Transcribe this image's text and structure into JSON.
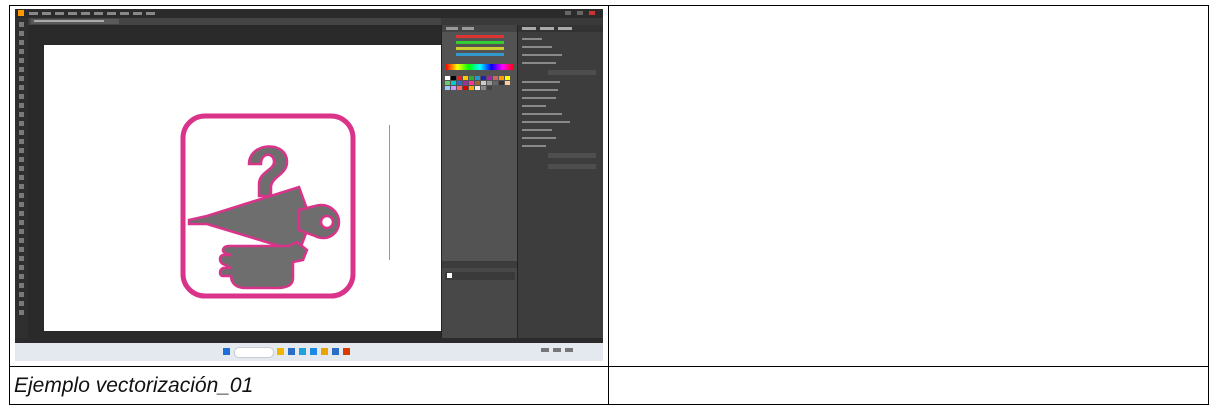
{
  "caption": {
    "text": "Ejemplo vectorización_01"
  },
  "screenshot": {
    "app": "Adobe Illustrator",
    "icon_stroke_color": "#d9338a",
    "icon_fill_color": "#6e6e6e",
    "icons": [
      "question-mark-icon",
      "umbrella-icon",
      "glove-hand-icon"
    ]
  },
  "colors": {
    "page_bg": "#ffffff",
    "table_border": "#000000",
    "app_dark": "#3a3a3a",
    "taskbar": "#e4e9ef",
    "accent_orange": "#ff9a00"
  }
}
